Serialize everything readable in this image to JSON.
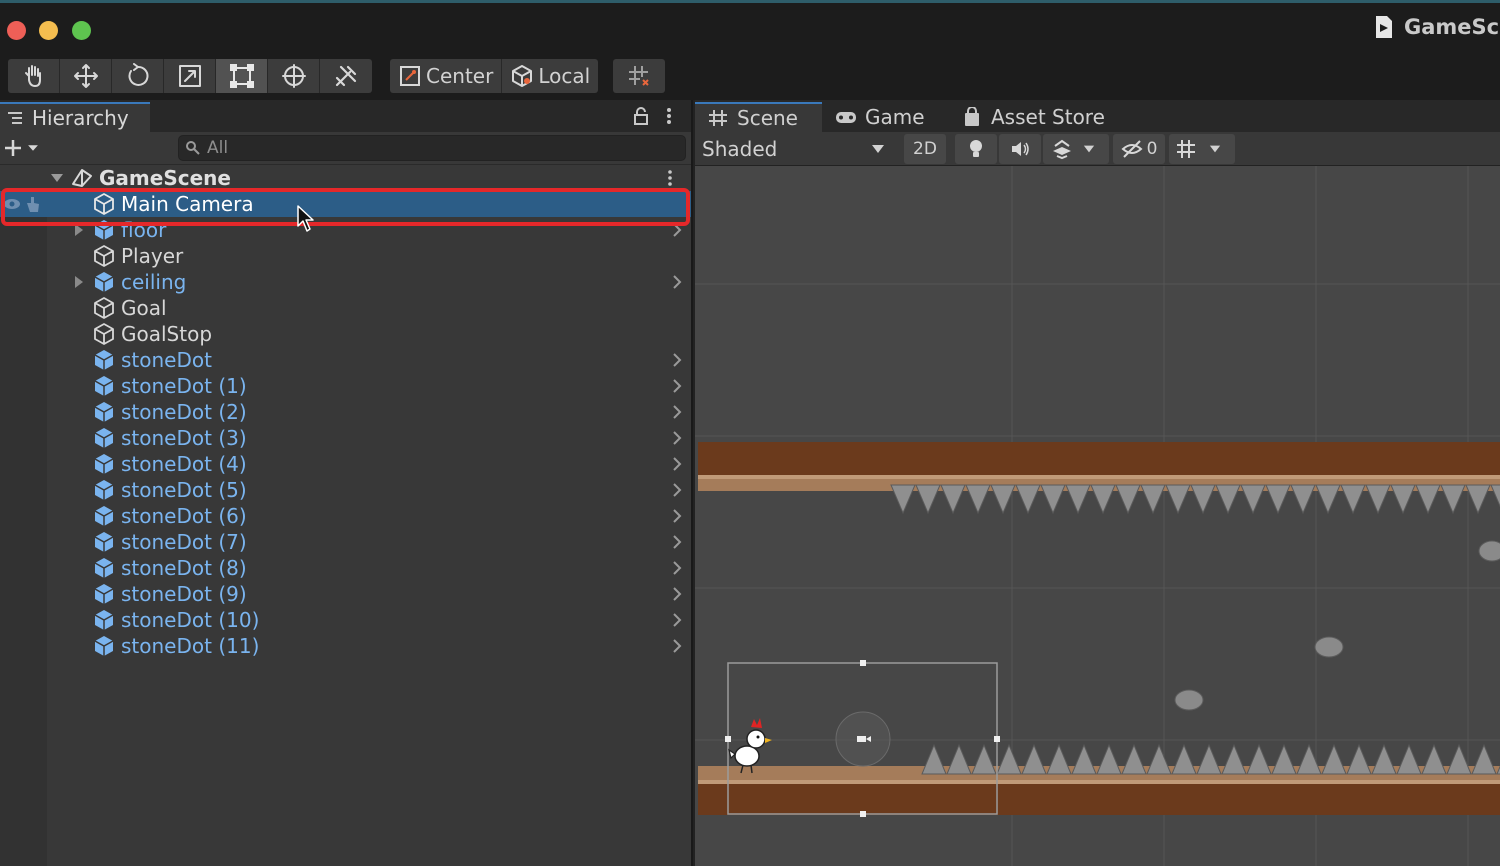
{
  "window": {
    "title": "GameSce"
  },
  "toolbar": {
    "tools": [
      {
        "name": "hand-tool"
      },
      {
        "name": "move-tool"
      },
      {
        "name": "rotate-tool"
      },
      {
        "name": "scale-tool"
      },
      {
        "name": "rect-tool",
        "active": true
      },
      {
        "name": "transform-tool"
      },
      {
        "name": "custom-tool"
      }
    ],
    "pivot_mode": "Center",
    "pivot_rotation": "Local"
  },
  "hierarchy": {
    "tab_label": "Hierarchy",
    "search_placeholder": "All",
    "scene_name": "GameScene",
    "items": [
      {
        "label": "Main Camera",
        "prefab": false,
        "has_children": false,
        "selected": true
      },
      {
        "label": "floor",
        "prefab": true,
        "has_children": true,
        "expandable": true
      },
      {
        "label": "Player",
        "prefab": false,
        "has_children": false
      },
      {
        "label": "ceiling",
        "prefab": true,
        "has_children": true,
        "expandable": true
      },
      {
        "label": "Goal",
        "prefab": false,
        "has_children": false
      },
      {
        "label": "GoalStop",
        "prefab": false,
        "has_children": false
      },
      {
        "label": "stoneDot",
        "prefab": true,
        "has_children": true
      },
      {
        "label": "stoneDot (1)",
        "prefab": true,
        "has_children": true
      },
      {
        "label": "stoneDot (2)",
        "prefab": true,
        "has_children": true
      },
      {
        "label": "stoneDot (3)",
        "prefab": true,
        "has_children": true
      },
      {
        "label": "stoneDot (4)",
        "prefab": true,
        "has_children": true
      },
      {
        "label": "stoneDot (5)",
        "prefab": true,
        "has_children": true
      },
      {
        "label": "stoneDot (6)",
        "prefab": true,
        "has_children": true
      },
      {
        "label": "stoneDot (7)",
        "prefab": true,
        "has_children": true
      },
      {
        "label": "stoneDot (8)",
        "prefab": true,
        "has_children": true
      },
      {
        "label": "stoneDot (9)",
        "prefab": true,
        "has_children": true
      },
      {
        "label": "stoneDot (10)",
        "prefab": true,
        "has_children": true
      },
      {
        "label": "stoneDot (11)",
        "prefab": true,
        "has_children": true
      }
    ]
  },
  "scene_view": {
    "tabs": [
      {
        "label": "Scene",
        "icon": "grid-icon",
        "active": true
      },
      {
        "label": "Game",
        "icon": "gamepad-icon"
      },
      {
        "label": "Asset Store",
        "icon": "shopping-bag-icon"
      }
    ],
    "shading_mode": "Shaded",
    "mode_2d_label": "2D",
    "hidden_count": "0"
  },
  "colors": {
    "accent": "#3a79bb",
    "selection": "#2c5d87",
    "highlight": "#e5282a",
    "prefab_text": "#7ab4ef",
    "ground": "#6b3a1c",
    "ground_top": "#a57c5a",
    "spike": "#8f8f8f"
  }
}
